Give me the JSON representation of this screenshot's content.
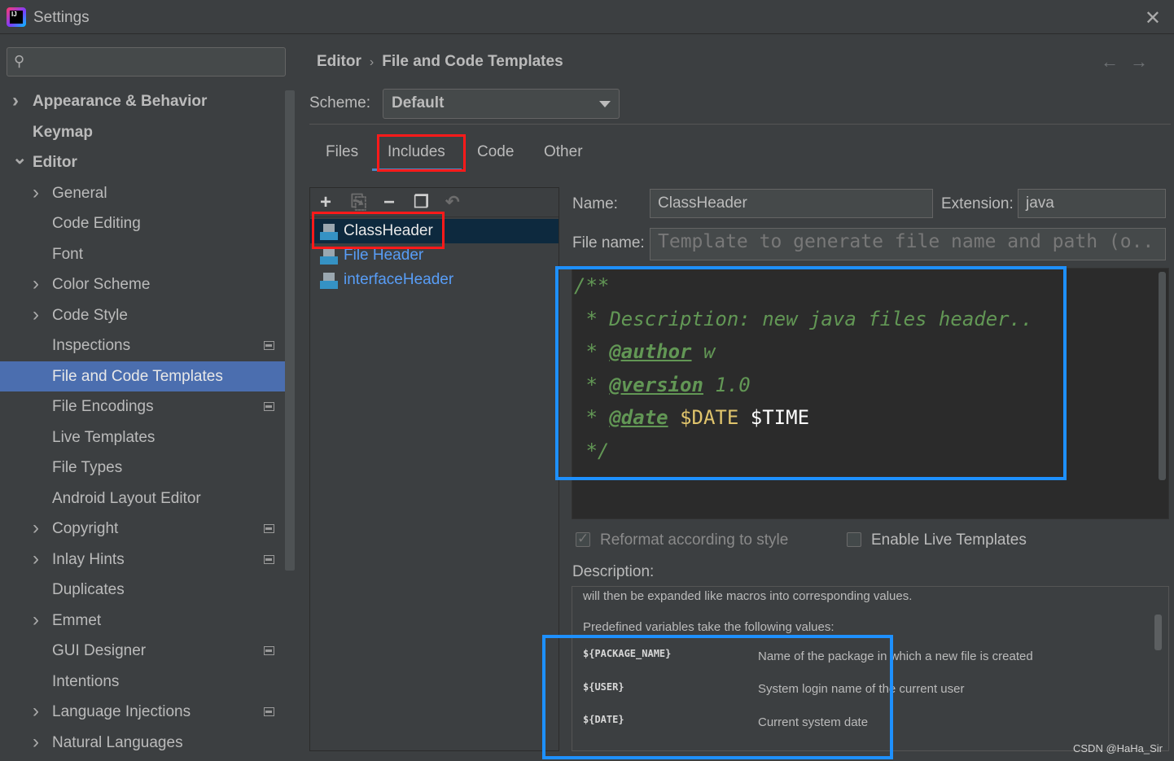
{
  "window": {
    "title": "Settings"
  },
  "sidebar": {
    "items": [
      {
        "label": "Appearance & Behavior",
        "chevron": "right",
        "bold": true,
        "level": 0
      },
      {
        "label": "Keymap",
        "chevron": "",
        "bold": true,
        "level": 0
      },
      {
        "label": "Editor",
        "chevron": "down",
        "bold": true,
        "level": 0
      },
      {
        "label": "General",
        "chevron": "right",
        "level": 1
      },
      {
        "label": "Code Editing",
        "chevron": "",
        "level": 1
      },
      {
        "label": "Font",
        "chevron": "",
        "level": 1
      },
      {
        "label": "Color Scheme",
        "chevron": "right",
        "level": 1
      },
      {
        "label": "Code Style",
        "chevron": "right",
        "level": 1
      },
      {
        "label": "Inspections",
        "chevron": "",
        "level": 1,
        "badge": true
      },
      {
        "label": "File and Code Templates",
        "chevron": "",
        "level": 1,
        "selected": true
      },
      {
        "label": "File Encodings",
        "chevron": "",
        "level": 1,
        "badge": true
      },
      {
        "label": "Live Templates",
        "chevron": "",
        "level": 1
      },
      {
        "label": "File Types",
        "chevron": "",
        "level": 1
      },
      {
        "label": "Android Layout Editor",
        "chevron": "",
        "level": 1
      },
      {
        "label": "Copyright",
        "chevron": "right",
        "level": 1,
        "badge": true
      },
      {
        "label": "Inlay Hints",
        "chevron": "right",
        "level": 1,
        "badge": true
      },
      {
        "label": "Duplicates",
        "chevron": "",
        "level": 1
      },
      {
        "label": "Emmet",
        "chevron": "right",
        "level": 1
      },
      {
        "label": "GUI Designer",
        "chevron": "",
        "level": 1,
        "badge": true
      },
      {
        "label": "Intentions",
        "chevron": "",
        "level": 1
      },
      {
        "label": "Language Injections",
        "chevron": "right",
        "level": 1,
        "badge": true
      },
      {
        "label": "Natural Languages",
        "chevron": "right",
        "level": 1
      }
    ]
  },
  "breadcrumb": {
    "parent": "Editor",
    "current": "File and Code Templates",
    "separator": "›"
  },
  "nav": {
    "back": "←",
    "forward": "→"
  },
  "scheme": {
    "label": "Scheme:",
    "value": "Default"
  },
  "tabs": [
    {
      "label": "Files"
    },
    {
      "label": "Includes",
      "active": true
    },
    {
      "label": "Code"
    },
    {
      "label": "Other"
    }
  ],
  "toolbar": {
    "add": "+",
    "copy": "⎘",
    "remove": "−",
    "duplicate": "❐",
    "reset": "↶"
  },
  "templates": [
    {
      "label": "ClassHeader",
      "selected": true
    },
    {
      "label": "File Header"
    },
    {
      "label": "interfaceHeader"
    }
  ],
  "form": {
    "name_label": "Name:",
    "name_value": "ClassHeader",
    "extension_label": "Extension:",
    "extension_value": "java",
    "filename_label": "File name:",
    "filename_placeholder": "Template to generate file name and path (o.."
  },
  "code": {
    "line1": "/**",
    "line2": " * Description: new java files header..",
    "line3_prefix": " * ",
    "line3_tag": "@author",
    "line3_rest": " w",
    "line4_prefix": " * ",
    "line4_tag": "@version",
    "line4_rest": " 1.0",
    "line5_prefix": " * ",
    "line5_tag": "@date",
    "line5_var1": "$DATE",
    "line5_var2": "$TIME",
    "line6": " */"
  },
  "options": {
    "reformat_label": "Reformat according to style",
    "reformat_checked": true,
    "live_templates_label": "Enable Live Templates",
    "live_templates_checked": false
  },
  "description": {
    "label": "Description:",
    "line1": "will then be expanded like macros into corresponding values.",
    "line2": "Predefined variables take the following values:",
    "vars": [
      {
        "name": "${PACKAGE_NAME}",
        "value": "Name of the package in which a new file is created"
      },
      {
        "name": "${USER}",
        "value": "System login name of the current user"
      },
      {
        "name": "${DATE}",
        "value": "Current system date"
      }
    ]
  },
  "watermark": "CSDN @HaHa_Sir",
  "colors": {
    "selection": "#4b6eaf",
    "highlight_red": "#ff1a1a",
    "highlight_blue": "#1e90ff",
    "comment_green": "#629755"
  }
}
